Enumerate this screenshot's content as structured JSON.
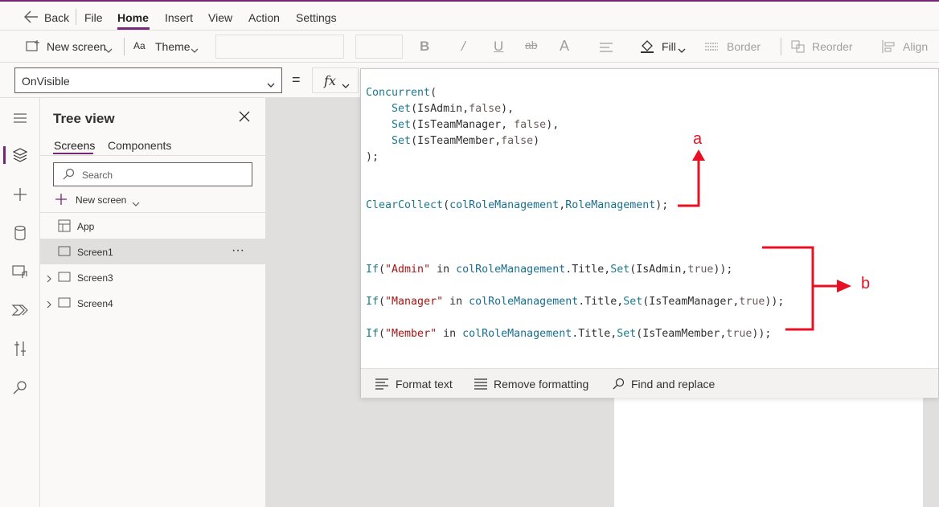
{
  "menu": {
    "back": "Back",
    "items": [
      "File",
      "Home",
      "Insert",
      "View",
      "Action",
      "Settings"
    ]
  },
  "toolbar": {
    "new_screen": "New screen",
    "theme": "Theme",
    "fill": "Fill",
    "border": "Border",
    "reorder": "Reorder",
    "align": "Align"
  },
  "formula_bar": {
    "property": "OnVisible",
    "equals": "=",
    "fx": "fx"
  },
  "tree": {
    "title": "Tree view",
    "tabs": [
      "Screens",
      "Components"
    ],
    "search_placeholder": "Search",
    "new_screen": "New screen",
    "items": [
      {
        "label": "App"
      },
      {
        "label": "Screen1"
      },
      {
        "label": "Screen3"
      },
      {
        "label": "Screen4"
      }
    ],
    "more": "···"
  },
  "editor": {
    "footer": {
      "format_text": "Format text",
      "remove_formatting": "Remove formatting",
      "find_replace": "Find and replace"
    }
  },
  "annotations": {
    "a": "a",
    "b": "b",
    "color": "#e81123"
  },
  "colors": {
    "accent": "#742774"
  }
}
